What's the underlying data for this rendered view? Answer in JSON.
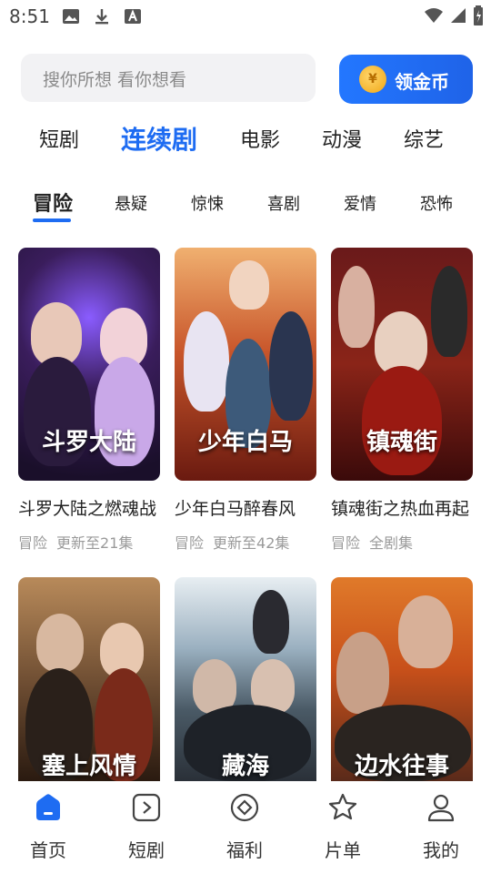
{
  "status_bar": {
    "time": "8:51"
  },
  "search": {
    "placeholder": "搜你所想 看你想看"
  },
  "coin_button": {
    "label": "领金币",
    "coin_symbol": "¥"
  },
  "main_tabs": [
    "短剧",
    "连续剧",
    "电影",
    "动漫",
    "综艺"
  ],
  "main_tab_active": 1,
  "sub_tabs": [
    "冒险",
    "悬疑",
    "惊悚",
    "喜剧",
    "爱情",
    "恐怖"
  ],
  "sub_tab_active": 0,
  "cards": [
    {
      "title": "斗罗大陆之燃魂战",
      "genre": "冒险",
      "status": "更新至21集",
      "poster_text": "斗罗大陆"
    },
    {
      "title": "少年白马醉春风",
      "genre": "冒险",
      "status": "更新至42集",
      "poster_text": "少年白马"
    },
    {
      "title": "镇魂街之热血再起",
      "genre": "冒险",
      "status": "全剧集",
      "poster_text": "镇魂街"
    },
    {
      "title": "",
      "genre": "",
      "status": "",
      "poster_text": "塞上风情"
    },
    {
      "title": "",
      "genre": "",
      "status": "",
      "poster_text": "藏海"
    },
    {
      "title": "",
      "genre": "",
      "status": "",
      "poster_text": "边水往事"
    }
  ],
  "bottom_nav": [
    {
      "label": "首页",
      "icon": "home-icon"
    },
    {
      "label": "短剧",
      "icon": "play-square-icon"
    },
    {
      "label": "福利",
      "icon": "gift-diamond-icon"
    },
    {
      "label": "片单",
      "icon": "star-icon"
    },
    {
      "label": "我的",
      "icon": "user-icon"
    }
  ],
  "colors": {
    "accent": "#1e6cf2",
    "coin": "#f0a615"
  }
}
